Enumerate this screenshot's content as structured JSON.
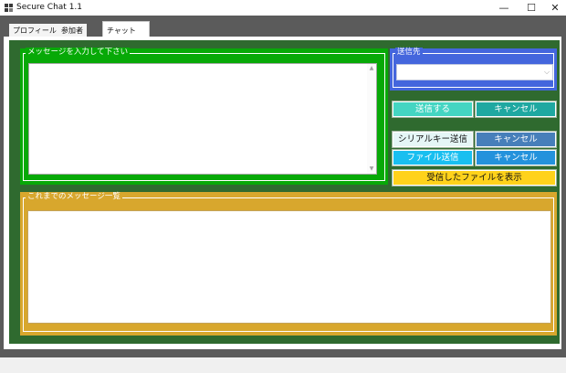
{
  "window": {
    "title": "Secure Chat 1.1",
    "minimize_glyph": "—",
    "maximize_glyph": "☐",
    "close_glyph": "✕",
    "icon": "app-window-icon"
  },
  "tabs": [
    {
      "label": "プロフィール",
      "active": false
    },
    {
      "label": "参加者",
      "active": false
    },
    {
      "label": "チャット",
      "active": true
    }
  ],
  "message_group": {
    "legend": "メッセージを入力して下さい",
    "input_value": ""
  },
  "destination_group": {
    "legend": "送信先",
    "selected_value": ""
  },
  "buttons": {
    "send": "送信する",
    "cancel_send": "キャンセル",
    "serial_send": "シリアルキー送信",
    "cancel_serial": "キャンセル",
    "file_send": "ファイル送信",
    "cancel_file": "キャンセル",
    "show_received_files": "受信したファイルを表示"
  },
  "history_group": {
    "legend": "これまでのメッセージ一覧",
    "items": []
  },
  "colors": {
    "message_group_bg": "#07a907",
    "destination_group_bg": "#4466dd",
    "history_group_bg": "#d8a72d",
    "panel_bg": "#2f6a2f"
  }
}
